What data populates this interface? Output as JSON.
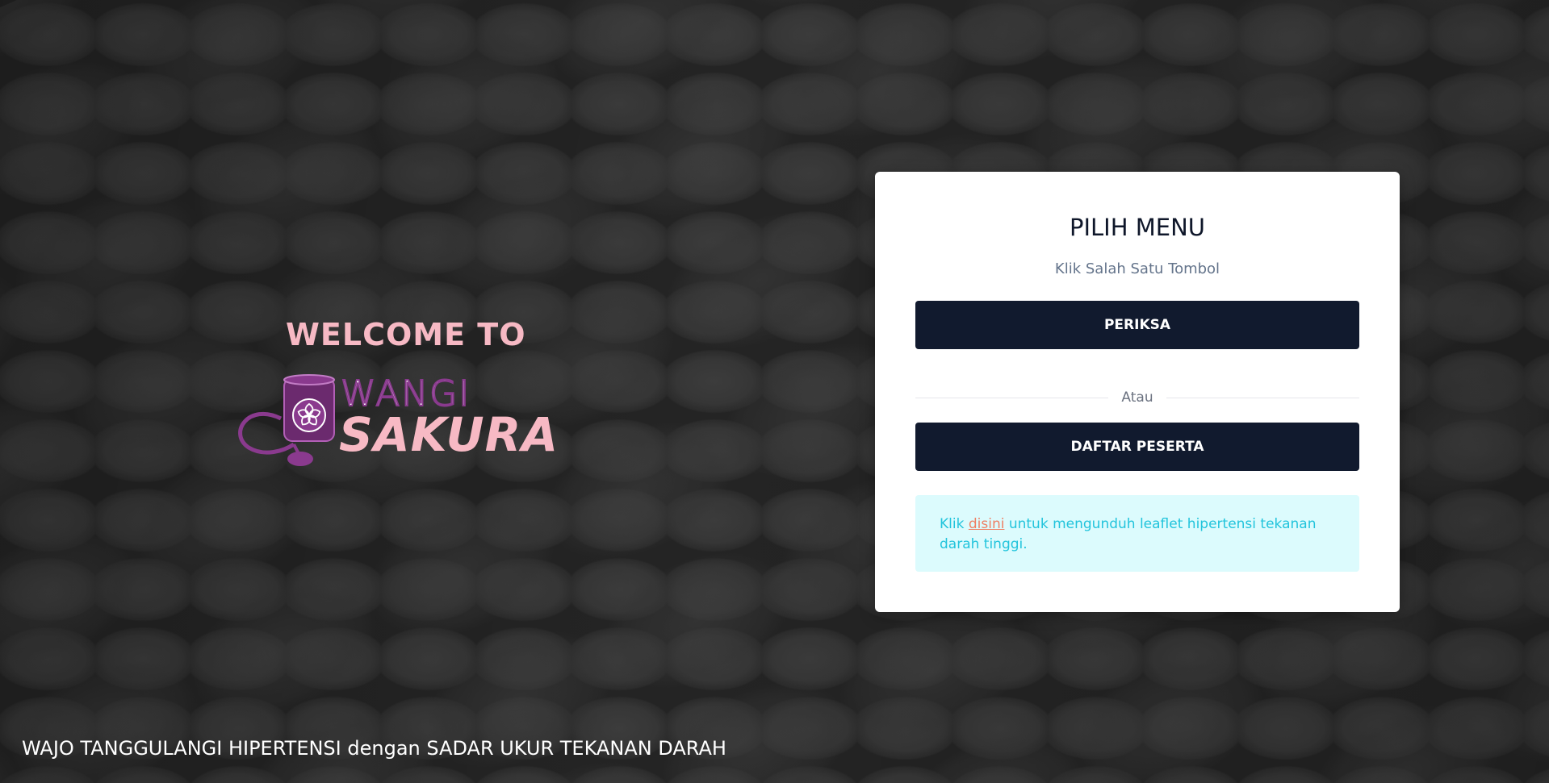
{
  "branding": {
    "welcome": "WELCOME TO",
    "logo_word_1": "WANGI",
    "logo_word_2": "SAKURA",
    "colors": {
      "pink": "#f7b9c4",
      "purple": "#8a3a8e"
    }
  },
  "card": {
    "title": "PILIH MENU",
    "subtitle": "Klik Salah Satu Tombol",
    "primary_button": "PERIKSA",
    "divider_text": "Atau",
    "secondary_button": "DAFTAR PESERTA",
    "button_color": "#111a2e",
    "notice": {
      "prefix": "Klik ",
      "link_text": "disini",
      "suffix": " untuk mengunduh leaflet hipertensi tekanan darah tinggi.",
      "background": "#dcfbfd",
      "text_color": "#22c4dc",
      "link_color": "#ef7f63"
    }
  },
  "footer": {
    "tagline": "WAJO TANGGULANGI HIPERTENSI dengan SADAR UKUR TEKANAN DARAH"
  }
}
